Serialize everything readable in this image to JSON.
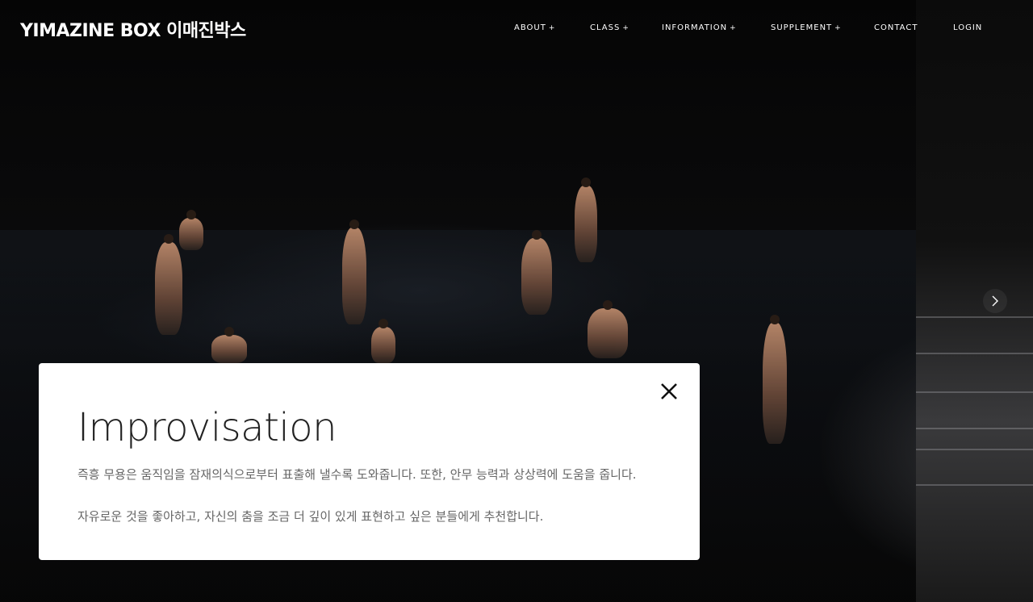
{
  "header": {
    "logo": "YIMAZINE BOX 이매진박스",
    "nav": [
      {
        "label": "ABOUT",
        "has_submenu": true
      },
      {
        "label": "CLASS",
        "has_submenu": true
      },
      {
        "label": "INFORMATION",
        "has_submenu": true
      },
      {
        "label": "SUPPLEMENT",
        "has_submenu": true
      },
      {
        "label": "CONTACT",
        "has_submenu": false
      },
      {
        "label": "LOGIN",
        "has_submenu": false
      }
    ],
    "submenu_marker": "+"
  },
  "slider": {
    "next_icon": "chevron-right-icon"
  },
  "card": {
    "title": "Improvisation",
    "paragraphs": [
      "즉흥 무용은 움직임을 잠재의식으로부터 표출해 낼수록 도와줍니다. 또한, 안무 능력과 상상력에 도움을 줍니다.",
      "자유로운 것을 좋아하고, 자신의 춤을 조금 더 깊이 있게 표현하고 싶은 분들에게 추천합니다."
    ],
    "close_icon": "close-icon"
  },
  "colors": {
    "background": "#000000",
    "card_bg": "#ffffff",
    "title": "#222222",
    "body_text": "#666666",
    "nav_text": "#ffffff"
  }
}
